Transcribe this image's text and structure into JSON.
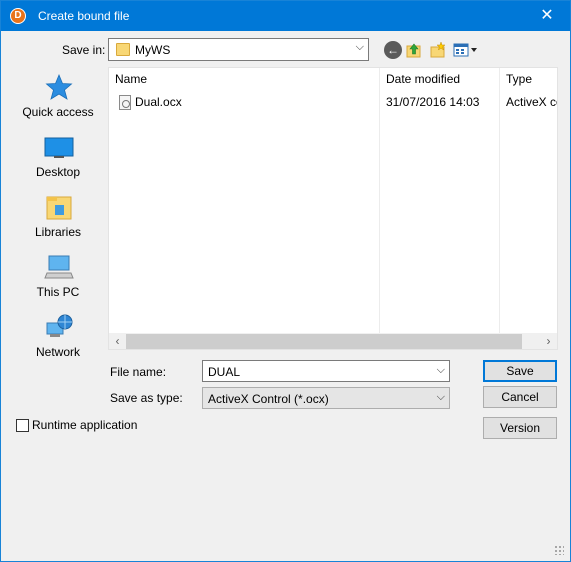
{
  "window": {
    "title": "Create bound file",
    "close_glyph": "✕",
    "app_icon_glyph": "D"
  },
  "toolbar": {
    "save_in_label": "Save in:",
    "save_in_value": "MyWS",
    "icons": [
      "back-icon",
      "up-folder-icon",
      "new-folder-icon",
      "view-menu-icon"
    ]
  },
  "places": [
    {
      "label": "Quick access",
      "icon": "star-icon"
    },
    {
      "label": "Desktop",
      "icon": "desktop-icon"
    },
    {
      "label": "Libraries",
      "icon": "libraries-icon"
    },
    {
      "label": "This PC",
      "icon": "computer-icon"
    },
    {
      "label": "Network",
      "icon": "network-icon"
    }
  ],
  "filelist": {
    "columns": [
      "Name",
      "Date modified",
      "Type"
    ],
    "rows": [
      {
        "name": "Dual.ocx",
        "date": "31/07/2016 14:03",
        "type": "ActiveX co"
      }
    ]
  },
  "form": {
    "filename_label": "File name:",
    "filename_value": "DUAL",
    "savetype_label": "Save as type:",
    "savetype_value": "ActiveX Control (*.ocx)"
  },
  "buttons": {
    "save": "Save",
    "cancel": "Cancel",
    "version": "Version"
  },
  "runtime": {
    "label": "Runtime application",
    "checked": false
  },
  "colors": {
    "titlebar": "#0078d7",
    "accent": "#0078d7"
  }
}
